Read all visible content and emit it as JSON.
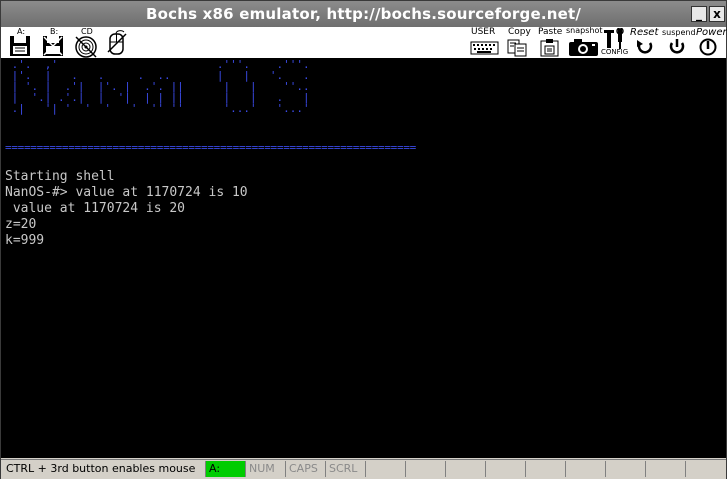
{
  "window": {
    "title": "Bochs x86 emulator, http://bochs.sourceforge.net/",
    "minimize_glyph": "_",
    "close_glyph": "x"
  },
  "toolbar": {
    "floppy_a_label": "A:",
    "floppy_b_label": "B:",
    "cdrom_label": "CD",
    "user_label": "USER",
    "copy_label": "Copy",
    "paste_label": "Paste",
    "snapshot_label": "snapshot",
    "config_label": "CONFIG",
    "reset_label": "Reset",
    "suspend_label": "suspend",
    "power_label": "Power"
  },
  "screen": {
    "logo_art": " .'.  ,'                        .'''.    .'''.\n |'.  |   .   .     .  ..       |   |   '.   .\n | '. |  .'|  |'. |  .'. ||      |   |    ''..\n |  '.| .'.|  |  '|  | | ||      |   |   .   |\n .|   '| '  '  '   '  '' ''      '...'   '...'",
    "separator": "=================================================================",
    "lines": [
      "Starting shell",
      "NanOS-#> value at 1170724 is 10",
      " value at 1170724 is 20",
      "z=20",
      "k=999"
    ],
    "text_color": "#c8c8c8",
    "art_color": "#3b4be8"
  },
  "status": {
    "hint": "CTRL + 3rd button enables mouse",
    "drive_a": "A:",
    "num": "NUM",
    "caps": "CAPS",
    "scrl": "SCRL",
    "drive_active_color": "#00cc00"
  }
}
